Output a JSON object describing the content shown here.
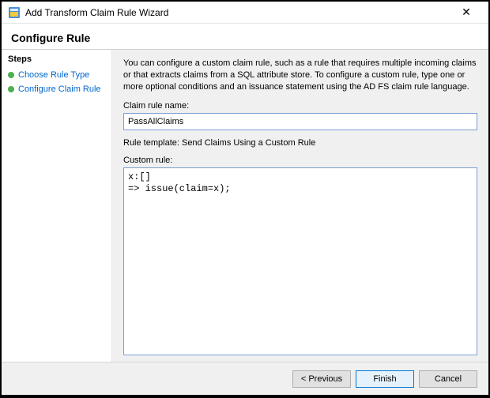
{
  "window": {
    "title": "Add Transform Claim Rule Wizard",
    "close_label": "✕"
  },
  "header": {
    "title": "Configure Rule"
  },
  "sidebar": {
    "heading": "Steps",
    "items": [
      {
        "label": "Choose Rule Type"
      },
      {
        "label": "Configure Claim Rule"
      }
    ]
  },
  "main": {
    "description": "You can configure a custom claim rule, such as a rule that requires multiple incoming claims or that extracts claims from a SQL attribute store. To configure a custom rule, type one or more optional conditions and an issuance statement using the AD FS claim rule language.",
    "name_label": "Claim rule name:",
    "name_value": "PassAllClaims",
    "template_label": "Rule template: Send Claims Using a Custom Rule",
    "custom_label": "Custom rule:",
    "custom_value": "x:[]\n=> issue(claim=x);"
  },
  "footer": {
    "previous": "< Previous",
    "finish": "Finish",
    "cancel": "Cancel"
  }
}
